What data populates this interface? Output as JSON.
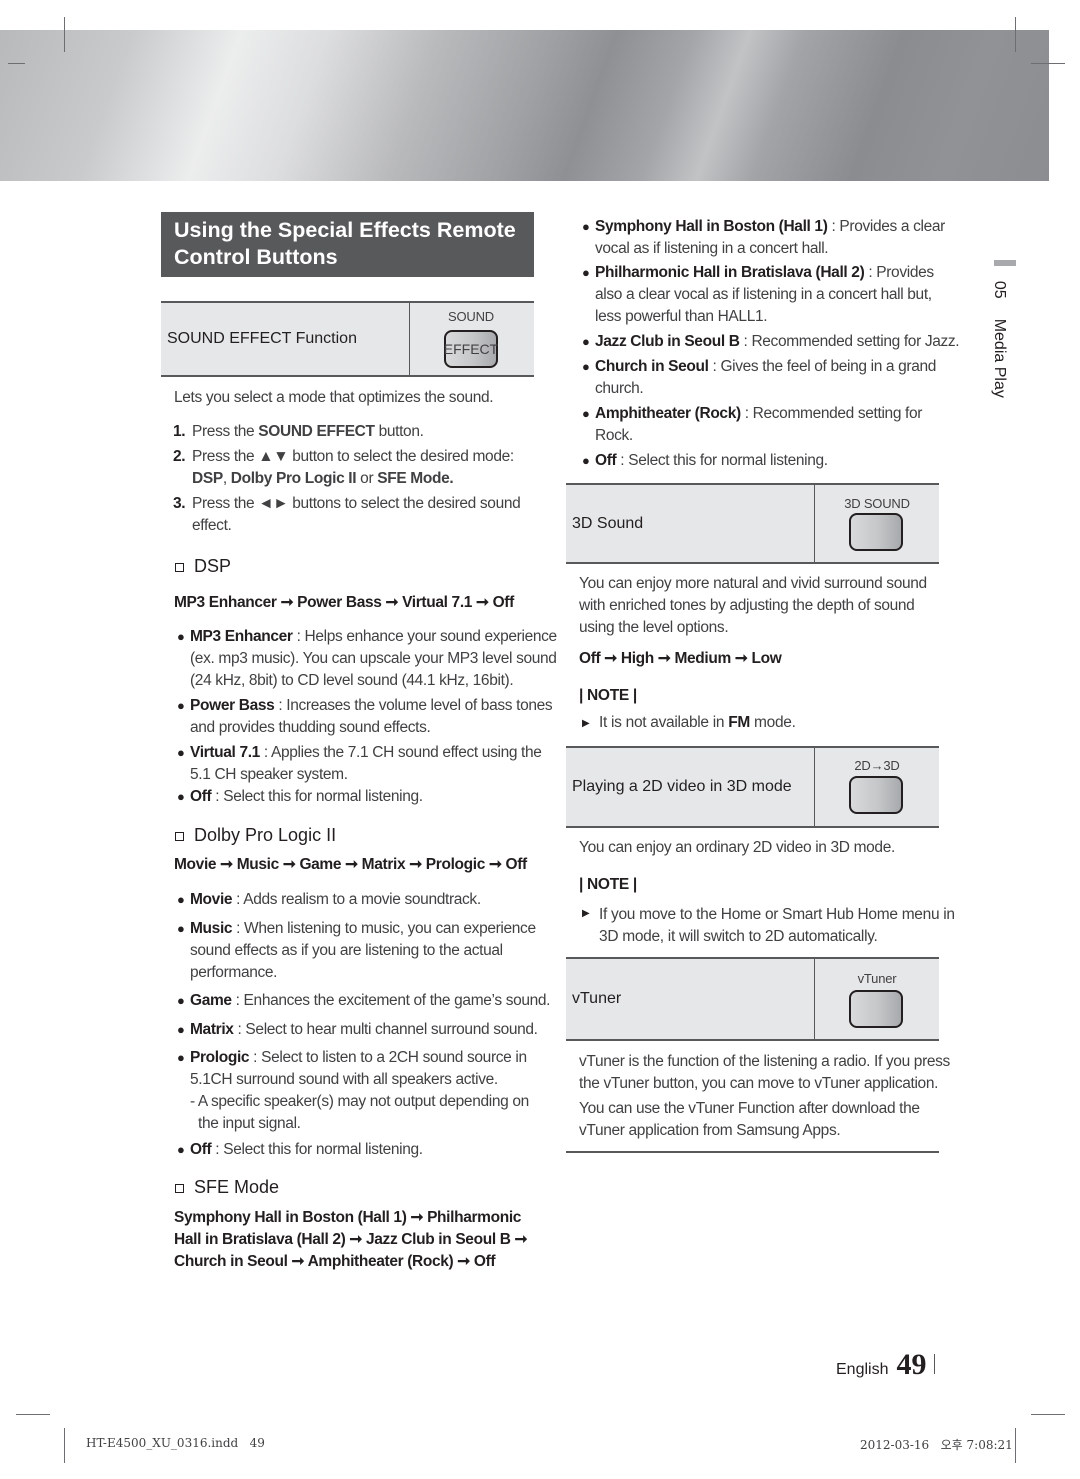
{
  "section": {
    "title_line1": "Using the Special Effects Remote",
    "title_line2": "Control Buttons"
  },
  "sound_effect": {
    "function_label": "SOUND EFFECT Function",
    "button_caption": "SOUND",
    "button_label": "EFFECT",
    "intro": "Lets you select a mode that optimizes the sound.",
    "steps": [
      {
        "num": "1.",
        "pre": "Press the ",
        "bold": "SOUND EFFECT",
        "post": " button."
      },
      {
        "num": "2.",
        "line1": "Press the ▲▼ button to select the desired mode:",
        "line2_b1": "DSP",
        "line2_t1": ", ",
        "line2_b2": "Dolby Pro Logic II",
        "line2_t2": " or ",
        "line2_b3": "SFE Mode."
      },
      {
        "num": "3.",
        "line1": "Press the ◄► buttons to select the desired sound",
        "line2": "effect."
      }
    ]
  },
  "dsp": {
    "heading": "DSP",
    "sequence": "MP3 Enhancer ➞ Power Bass ➞ Virtual 7.1 ➞ Off",
    "items": [
      {
        "name": "MP3 Enhancer",
        "desc1": " : Helps enhance your sound experience",
        "desc2": "(ex. mp3 music). You can upscale your MP3 level sound",
        "desc3": "(24 kHz, 8bit) to CD level sound (44.1 kHz, 16bit)."
      },
      {
        "name": "Power Bass",
        "desc1": " : Increases the volume level of bass tones",
        "desc2": "and provides thudding sound effects."
      },
      {
        "name": "Virtual 7.1",
        "desc1": " : Applies the 7.1 CH sound effect using the",
        "desc2": "5.1 CH speaker system."
      },
      {
        "name": "Off",
        "desc1": " : Select this for normal listening."
      }
    ]
  },
  "dolby": {
    "heading": "Dolby Pro Logic II",
    "sequence": "Movie ➞ Music ➞ Game ➞ Matrix ➞ Prologic ➞ Off",
    "items": [
      {
        "name": "Movie",
        "desc1": " : Adds realism to a movie soundtrack."
      },
      {
        "name": "Music",
        "desc1": " : When listening to music, you can experience",
        "desc2": "sound effects as if you are listening to the actual",
        "desc3": "performance."
      },
      {
        "name": "Game",
        "desc1": " : Enhances the excitement of the game’s sound."
      },
      {
        "name": "Matrix",
        "desc1": " : Select to hear multi channel surround sound."
      },
      {
        "name": "Prologic",
        "desc1": " : Select to listen to a 2CH sound source in",
        "desc2": "5.1CH surround sound with all speakers active.",
        "desc3": "- A specific speaker(s) may not output depending on",
        "desc4": "the input signal."
      },
      {
        "name": "Off",
        "desc1": " : Select this for normal listening."
      }
    ]
  },
  "sfe": {
    "heading": "SFE Mode",
    "sequence_line1": "Symphony Hall in Boston (Hall 1) ➞ Philharmonic",
    "sequence_line2": "Hall in Bratislava (Hall 2) ➞ Jazz Club in Seoul B ➞",
    "sequence_line3": "Church in Seoul ➞ Amphitheater (Rock) ➞ Off",
    "items": [
      {
        "name": "Symphony Hall in Boston (Hall 1)",
        "desc1": " : Provides a clear",
        "desc2": "vocal as if listening in a concert hall."
      },
      {
        "name": "Philharmonic Hall in Bratislava (Hall 2)",
        "desc1": " : Provides",
        "desc2": "also a clear vocal as if listening in a concert hall but,",
        "desc3": "less powerful than HALL1."
      },
      {
        "name": "Jazz Club in Seoul B",
        "desc1": " : Recommended setting for Jazz."
      },
      {
        "name": "Church in Seoul",
        "desc1": " : Gives the feel of being in a grand",
        "desc2": "church."
      },
      {
        "name": "Amphitheater (Rock)",
        "desc1": " : Recommended setting for",
        "desc2": "Rock."
      },
      {
        "name": "Off",
        "desc1": " : Select this for normal listening."
      }
    ]
  },
  "sound3d": {
    "function_label": "3D Sound",
    "button_caption": "3D SOUND",
    "desc1": "You can enjoy more natural and vivid surround sound",
    "desc2": "with enriched tones by adjusting the depth of sound",
    "desc3": "using the level options.",
    "sequence": "Off ➞ High ➞ Medium ➞ Low",
    "note_label": "| NOTE |",
    "note_pre": "It is not available in ",
    "note_bold": "FM",
    "note_post": " mode."
  },
  "video2d3d": {
    "function_label": "Playing a 2D video in 3D mode",
    "button_caption": "2D→3D",
    "desc": "You can enjoy an ordinary 2D video in 3D mode.",
    "note_label": "| NOTE |",
    "note1": "If you move to the Home or Smart Hub Home menu in",
    "note2": "3D mode, it will switch to 2D automatically."
  },
  "vtuner": {
    "function_label": "vTuner",
    "button_caption": "vTuner",
    "desc1": "vTuner is the function of the listening a radio. If you press",
    "desc2": "the vTuner button, you can move to vTuner application.",
    "desc3": "You can use the vTuner Function after download the",
    "desc4": "vTuner application from Samsung Apps."
  },
  "side_tab": {
    "chapter": "05",
    "title": "Media Play"
  },
  "footer": {
    "language": "English",
    "page_number": "49"
  },
  "print_slug": {
    "file": "HT-E4500_XU_0316.indd   49",
    "timestamp": "2012-03-16   오후 7:08:21"
  }
}
